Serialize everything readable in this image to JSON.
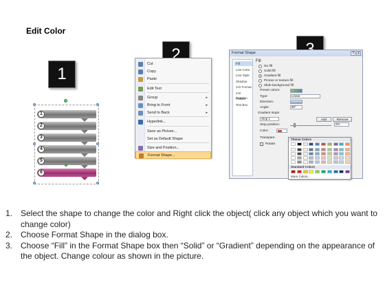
{
  "page": {
    "title": "Edit Color"
  },
  "badges": [
    "1",
    "2",
    "3"
  ],
  "shapes": {
    "numbers": [
      "1",
      "2",
      "3",
      "4",
      "5",
      "6"
    ],
    "selected_color": "#a03474"
  },
  "context_menu": {
    "items": [
      {
        "label": "Cut",
        "icon": "scissors-icon",
        "has_submenu": false
      },
      {
        "label": "Copy",
        "icon": "copy-icon",
        "has_submenu": false
      },
      {
        "label": "Paste",
        "icon": "paste-icon",
        "has_submenu": false
      },
      {
        "label": "Edit Text",
        "icon": "edit-text-icon",
        "has_submenu": false
      },
      {
        "label": "Group",
        "icon": "group-icon",
        "has_submenu": true
      },
      {
        "label": "Bring to Front",
        "icon": "bring-front-icon",
        "has_submenu": true
      },
      {
        "label": "Send to Back",
        "icon": "send-back-icon",
        "has_submenu": true
      },
      {
        "label": "Hyperlink...",
        "icon": "hyperlink-icon",
        "has_submenu": false
      },
      {
        "label": "Save as Picture...",
        "icon": "",
        "has_submenu": false
      },
      {
        "label": "Set as Default Shape",
        "icon": "",
        "has_submenu": false
      },
      {
        "label": "Size and Position...",
        "icon": "size-position-icon",
        "has_submenu": false
      },
      {
        "label": "Format Shape...",
        "icon": "format-shape-icon",
        "has_submenu": false,
        "highlighted": true
      }
    ]
  },
  "dialog": {
    "title": "Format Shape",
    "title_controls": [
      "?",
      "X"
    ],
    "nav": [
      "Fill",
      "Line Color",
      "Line Style",
      "Shadow",
      "3-D Format",
      "3-D Rotation",
      "Picture",
      "Text Box"
    ],
    "section": "Fill",
    "fill_options": [
      "No fill",
      "Solid fill",
      "Gradient fill",
      "Picture or texture fill",
      "Slide background fill"
    ],
    "fill_selected": 2,
    "fields": {
      "preset_colors": "Preset colors:",
      "type_label": "Type:",
      "type_value": "Linear",
      "direction_label": "Direction:",
      "angle_label": "Angle:",
      "angle_value": "90°",
      "gradient_stops": "Gradient stops",
      "stop_value": "Stop 1",
      "add_button": "Add",
      "remove_button": "Remove",
      "stop_position": "Stop position:",
      "stop_position_value": "0%",
      "color_label": "Color:",
      "transparency_label": "Transpare",
      "rotate_label": "Rotate"
    },
    "palette": {
      "theme_header": "Theme Colors",
      "standard_header": "Standard Colors",
      "more_colors": "More Colors...",
      "theme_colors": [
        "#ffffff",
        "#000000",
        "#eeece1",
        "#1f497d",
        "#4f81bd",
        "#c0504d",
        "#9bbb59",
        "#8064a2",
        "#4bacc6",
        "#f79646"
      ],
      "standard_colors": [
        "#c00000",
        "#ff0000",
        "#ffc000",
        "#ffff00",
        "#92d050",
        "#00b050",
        "#00b0f0",
        "#0070c0",
        "#002060",
        "#7030a0"
      ]
    }
  },
  "instructions": [
    {
      "num": "1.",
      "text": "Select the shape to change the color and Right click the object( click any object which you want to change color)"
    },
    {
      "num": "2.",
      "text": "Choose Format Shape in the dialog box."
    },
    {
      "num": "3.",
      "text": "Choose “Fill” in the Format Shape box then “Solid” or “Gradient” depending on the appearance of the object. Change colour as shown in the picture."
    }
  ]
}
